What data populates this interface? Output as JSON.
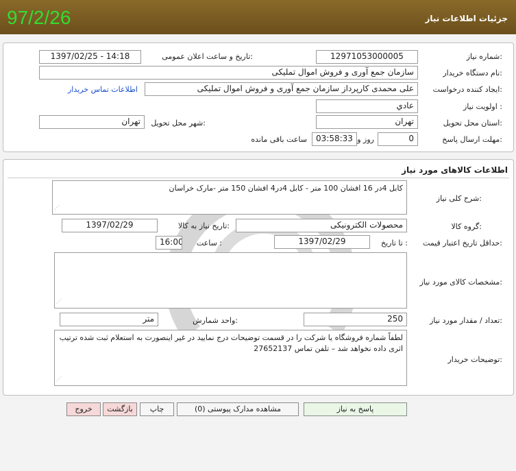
{
  "header": {
    "date": "97/2/26",
    "title": "جزئيات اطلاعات نياز"
  },
  "need": {
    "number_label": "شماره نياز:",
    "number": "12971053000005",
    "announce_label": "تاريخ و ساعت اعلان عمومی:",
    "announce_value": "1397/02/25 - 14:18",
    "buyer_label": "نام دستگاه خريدار:",
    "buyer": "سازمان جمع آوری و فروش اموال تمليکی",
    "creator_label": "ايجاد کننده درخواست:",
    "creator": "علی محمدی کارپرداز سازمان جمع آوری و فروش اموال تمليکی",
    "contact_link": "اطلاعات تماس خريدار",
    "priority_label": "اولويت نياز :",
    "priority": "عادي",
    "province_label": "استان محل تحويل:",
    "province": "تهران",
    "city_label": "شهر محل تحويل:",
    "city": "تهران",
    "deadline_label": "مهلت ارسال پاسخ:",
    "days": "0",
    "days_word": "روز و",
    "time_left": "03:58:33",
    "remaining_text": "ساعت باقی مانده"
  },
  "goods": {
    "section_title": "اطلاعات کالاهای مورد نياز",
    "summary_label": "شرح کلی نياز:",
    "summary": "کابل 4در 16  افشان 100 متر - کابل 4در4 افشان  150 متر -مارک خراسان",
    "group_label": "گروه کالا:",
    "group": "محصولات الکترونيکی",
    "need_date_label": "تاريخ نياز به کالا:",
    "need_date": "1397/02/29",
    "min_validity_label": "حداقل تاريخ اعتبار قيمت:",
    "to_date_label": "تا تاريخ :",
    "to_date": "1397/02/29",
    "time_label": "ساعت :",
    "time": "16:00",
    "specs_label": "مشخصات کالای مورد نياز:",
    "specs": "",
    "qty_label": "تعداد / مقدار مورد نياز:",
    "qty": "250",
    "unit_label": "واحد شمارش:",
    "unit": "متر",
    "buyer_notes_label": "توضيحات خريدار:",
    "buyer_notes": "لطفاً شماره فروشگاه يا شرکت را در قسمت توضيحات درج نماييد در غير اينصورت به استعلام ثبت شده ترتيب اثری داده نخواهد شد – تلفن تماس 27652137"
  },
  "buttons": {
    "respond": "پاسخ به نياز",
    "attachments": "مشاهده مدارک پيوستی (0)",
    "print": "چاپ",
    "back": "بازگشت",
    "exit": "خروج"
  },
  "colors": {
    "header_bg": "#7a5b22",
    "header_date": "#33dd33",
    "link": "#1a4fd0"
  }
}
